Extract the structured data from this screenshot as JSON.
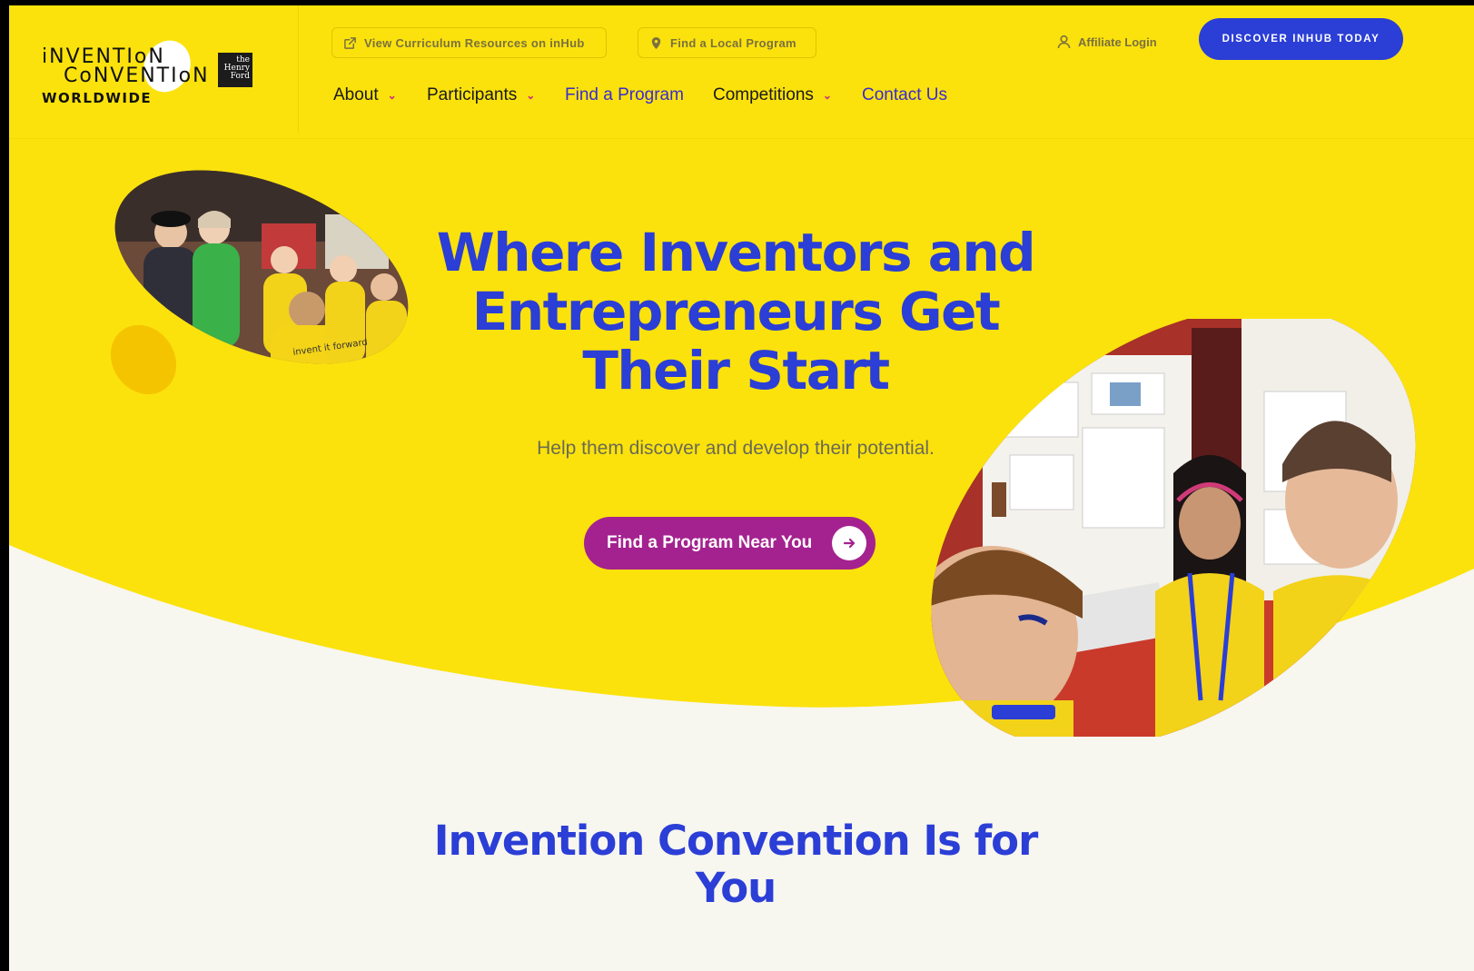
{
  "colors": {
    "yellow": "#fbe20c",
    "cream": "#f7f6ef",
    "blue": "#2b3ed6",
    "magenta": "#a4228f",
    "nav_link_blue": "#3a2bcf",
    "caret_pink": "#d1287a"
  },
  "logo": {
    "line1": "iNVENTIoN",
    "line2": "CoNVENTIoN",
    "line3": "WORLDWIDE",
    "partner_badge": "the Henry Ford"
  },
  "utility": {
    "curriculum_link": "View Curriculum Resources on inHub",
    "curriculum_icon": "external-link-icon",
    "local_program_link": "Find a Local Program",
    "local_program_icon": "location-pin-icon",
    "affiliate_login": "Affiliate Login",
    "affiliate_icon": "user-icon",
    "discover_button": "DISCOVER INHUB TODAY"
  },
  "nav": {
    "items": [
      {
        "label": "About",
        "dropdown": true
      },
      {
        "label": "Participants",
        "dropdown": true
      },
      {
        "label": "Find a Program",
        "dropdown": false
      },
      {
        "label": "Competitions",
        "dropdown": true
      },
      {
        "label": "Contact Us",
        "dropdown": false
      }
    ]
  },
  "hero": {
    "title_line1": "Where Inventors and",
    "title_line2": "Entrepreneurs Get",
    "title_line3": "Their Start",
    "subtitle": "Help them discover and develop their potential.",
    "cta_label": "Find a Program Near You",
    "cta_icon": "arrow-right-icon",
    "photo_left_caption": "invent it forward"
  },
  "section": {
    "title_line1": "Invention Convention Is for",
    "title_line2": "You"
  }
}
